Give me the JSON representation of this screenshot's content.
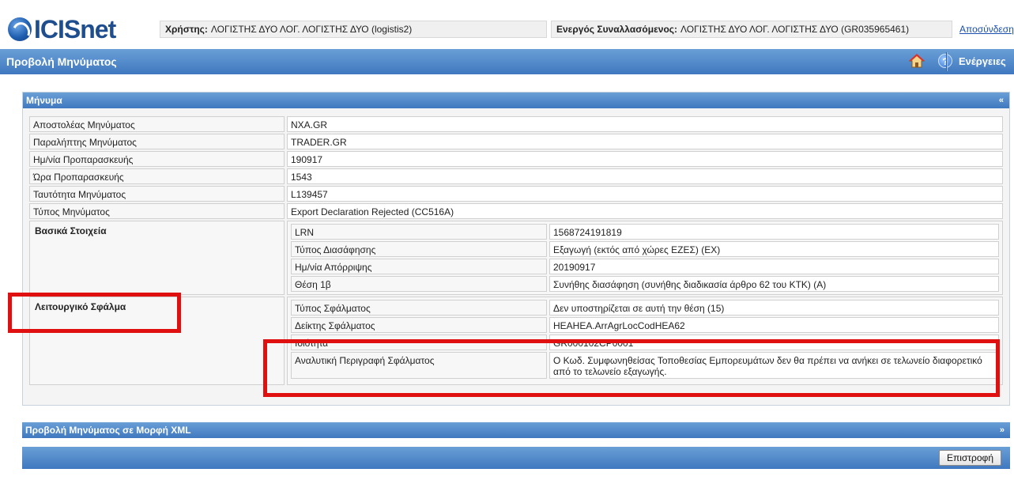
{
  "header": {
    "logo_text": "ICISnet",
    "user_label": "Χρήστης:",
    "user_value": "ΛΟΓΙΣΤΗΣ ΔΥΟ ΛΟΓ. ΛΟΓΙΣΤΗΣ ΔΥΟ (logistis2)",
    "trader_label": "Ενεργός Συναλλασόμενος:",
    "trader_value": "ΛΟΓΙΣΤΗΣ ΔΥΟ ΛΟΓ. ΛΟΓΙΣΤΗΣ ΔΥΟ (GR035965461)",
    "logout_label": "Αποσύνδεση"
  },
  "titlebar": {
    "title": "Προβολή Μηνύματος",
    "help_glyph": "?",
    "actions_label": "Ενέργειες"
  },
  "message_panel": {
    "title": "Μήνυμα",
    "collapse_glyph": "«",
    "rows": [
      {
        "label": "Αποστολέας Μηνύματος",
        "value": "NXA.GR"
      },
      {
        "label": "Παραλήπτης Μηνύματος",
        "value": "TRADER.GR"
      },
      {
        "label": "Ημ/νία Προπαρασκευής",
        "value": "190917"
      },
      {
        "label": "Ώρα Προπαρασκευής",
        "value": "1543"
      },
      {
        "label": "Ταυτότητα Μηνύματος",
        "value": "L139457"
      },
      {
        "label": "Τύπος Μηνύματος",
        "value": "Export Declaration Rejected (CC516A)"
      }
    ],
    "basic": {
      "title": "Βασικά Στοιχεία",
      "rows": [
        {
          "label": "LRN",
          "value": "1568724191819"
        },
        {
          "label": "Τύπος Διασάφησης",
          "value": "Εξαγωγή (εκτός από χώρες ΕΖΕΣ) (EX)"
        },
        {
          "label": "Ημ/νία Απόρριψης",
          "value": "20190917"
        },
        {
          "label": "Θέση 1β",
          "value": "Συνήθης διασάφηση (συνήθης διαδικασία άρθρο 62 του ΚΤΚ) (A)"
        }
      ]
    },
    "error": {
      "title": "Λειτουργικό Σφάλμα",
      "rows": [
        {
          "label": "Τύπος Σφάλματος",
          "value": "Δεν υποστηρίζεται σε αυτή την θέση (15)"
        },
        {
          "label": "Δείκτης Σφάλματος",
          "value": "HEAHEA.ArrAgrLocCodHEA62"
        },
        {
          "label": "Ιδιότητα",
          "value": "GR000102CP0001"
        },
        {
          "label": "Αναλυτική Περιγραφή Σφάλματος",
          "value": "Ο Κωδ. Συμφωνηθείσας Τοποθεσίας Εμπορευμάτων δεν θα πρέπει να ανήκει σε τελωνείο διαφορετικό από το τελωνείο εξαγωγής."
        }
      ]
    }
  },
  "xml_panel": {
    "title": "Προβολή Μηνύματος σε Μορφή XML",
    "expand_glyph": "»"
  },
  "footer": {
    "back_label": "Επιστροφή"
  },
  "colors": {
    "header_blue": "#3f78bf",
    "highlight_red": "#e01010",
    "link_blue": "#1a4fb0"
  }
}
